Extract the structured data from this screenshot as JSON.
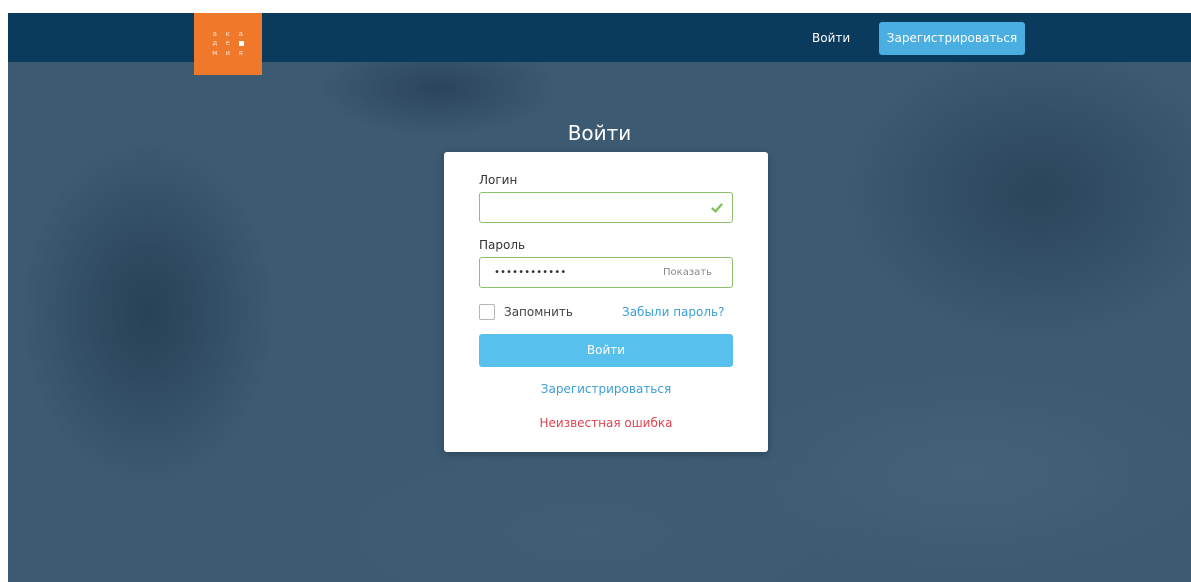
{
  "header": {
    "logo": {
      "row1": [
        "а",
        "к",
        "а"
      ],
      "row2": [
        "д",
        "е"
      ],
      "row3": [
        "м",
        "и",
        "я"
      ],
      "bg_color": "#f0782a"
    },
    "login_label": "Войти",
    "register_label": "Зарегистрироваться",
    "bar_color": "#0b3b5c",
    "register_color": "#4aaee0"
  },
  "form": {
    "title": "Войти",
    "login_label": "Логин",
    "login_value": "",
    "login_valid_icon": "check-icon",
    "password_label": "Пароль",
    "password_value": "••••••••••••",
    "show_password_label": "Показать",
    "remember_label": "Запомнить",
    "remember_checked": false,
    "forgot_label": "Забыли пароль?",
    "submit_label": "Войти",
    "register_label": "Зарегистрироваться",
    "error_message": "Неизвестная ошибка",
    "colors": {
      "valid_border": "#8dc06a",
      "submit": "#58c0ec",
      "link": "#3a9fd4",
      "error": "#e0424f"
    }
  }
}
